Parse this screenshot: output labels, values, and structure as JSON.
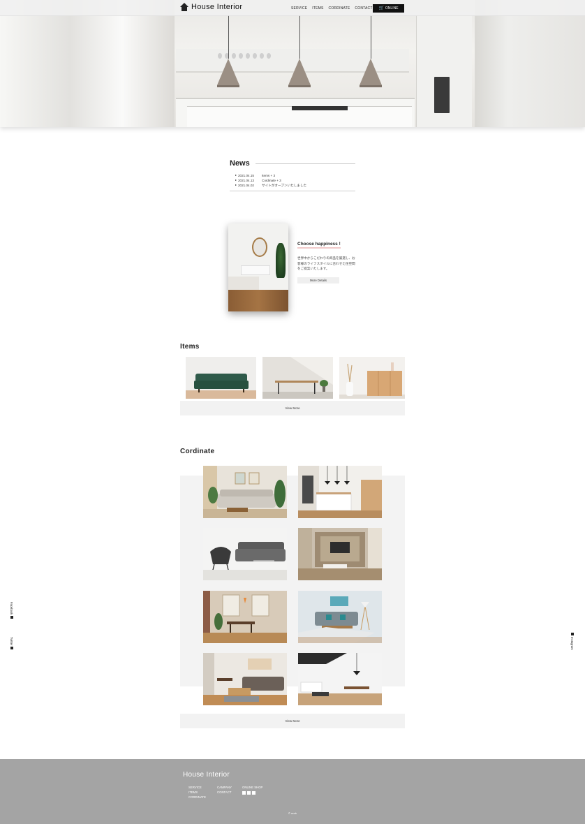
{
  "brand": {
    "name": "House Interior"
  },
  "nav": {
    "items": [
      "SERVICE",
      "ITEMS",
      "CORDINATE",
      "CONTACT"
    ],
    "online_label": "ONLINE"
  },
  "news": {
    "title": "News",
    "entries": [
      {
        "date": "2021.04.15",
        "text": "Items + 3"
      },
      {
        "date": "2021.04.13",
        "text": "Cordinate + 3"
      },
      {
        "date": "2021.04.02",
        "text": "サイトがオープンいたしました"
      }
    ]
  },
  "feature": {
    "heading": "Choose happiness !",
    "body": "世界中からこだわりの商品を厳選し、お客様のライフスタイルに合わせた住空間をご提案いたします。",
    "button_label": "More Details"
  },
  "items": {
    "title": "Items",
    "view_more": "View More"
  },
  "cordinate": {
    "title": "Cordinate",
    "view_more": "View More"
  },
  "side_links": {
    "facebook": "Facebook",
    "twitter": "Twitter",
    "instagram": "Instagram"
  },
  "footer": {
    "brand": "House Interior",
    "col1": [
      "SERVICE",
      "ITEMS",
      "CORDINATE"
    ],
    "col2": [
      "CAMPANY",
      "CONTACT"
    ],
    "col3_title": "ONLINE SHOP",
    "copyright": "© ocub"
  },
  "colors": {
    "accent_underline": "#f1c9c9",
    "footer_bg": "#a4a4a4",
    "button_dark": "#111111"
  }
}
